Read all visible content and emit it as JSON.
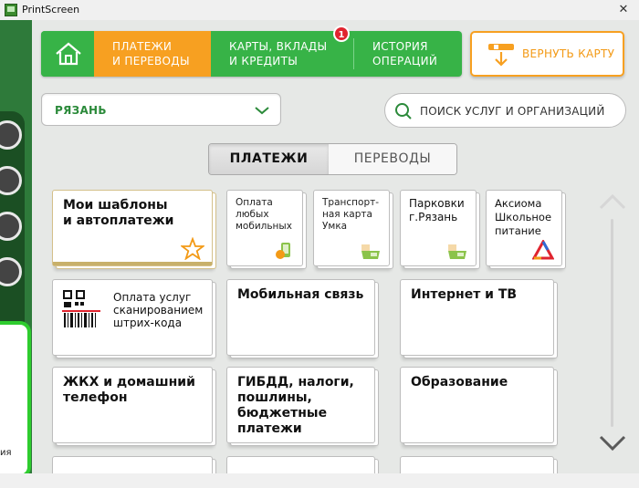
{
  "window": {
    "title": "PrintScreen"
  },
  "nav": {
    "items": [
      {
        "label": "ПЛАТЕЖИ\nИ ПЕРЕВОДЫ",
        "active": true
      },
      {
        "label": "КАРТЫ, ВКЛАДЫ\nИ КРЕДИТЫ",
        "active": false
      },
      {
        "label": "ИСТОРИЯ\nОПЕРАЦИЙ",
        "active": false
      }
    ],
    "badge": "1",
    "return_card_label": "ВЕРНУТЬ КАРТУ"
  },
  "city": {
    "selected": "РЯЗАНЬ"
  },
  "search": {
    "placeholder": "ПОИСК УСЛУГ И ОРГАНИЗАЦИЙ"
  },
  "tabs": [
    {
      "label": "ПЛАТЕЖИ",
      "active": true
    },
    {
      "label": "ПЕРЕВОДЫ",
      "active": false
    }
  ],
  "tiles": {
    "templates": "Мои шаблоны\nи автоплатежи",
    "mobile_any": "Оплата\nлюбых\nмобильных",
    "transport": "Транспорт-\nная карта\nУмка",
    "parking": "Парковки\nг.Рязань",
    "axioma": "Аксиома\nШкольное\nпитание",
    "barcode": "Оплата услуг\nсканированием\nштрих-кода",
    "mobile": "Мобильная связь",
    "internet": "Интернет и ТВ",
    "housing": "ЖКХ и домашний\nтелефон",
    "gibdd": "ГИБДД, налоги,\nпошлины,\nбюджетные\nплатежи",
    "education": "Образование"
  },
  "side": {
    "label": "ия"
  },
  "colors": {
    "green": "#37b347",
    "orange": "#f7a021",
    "dark_green": "#2e7a3a"
  }
}
